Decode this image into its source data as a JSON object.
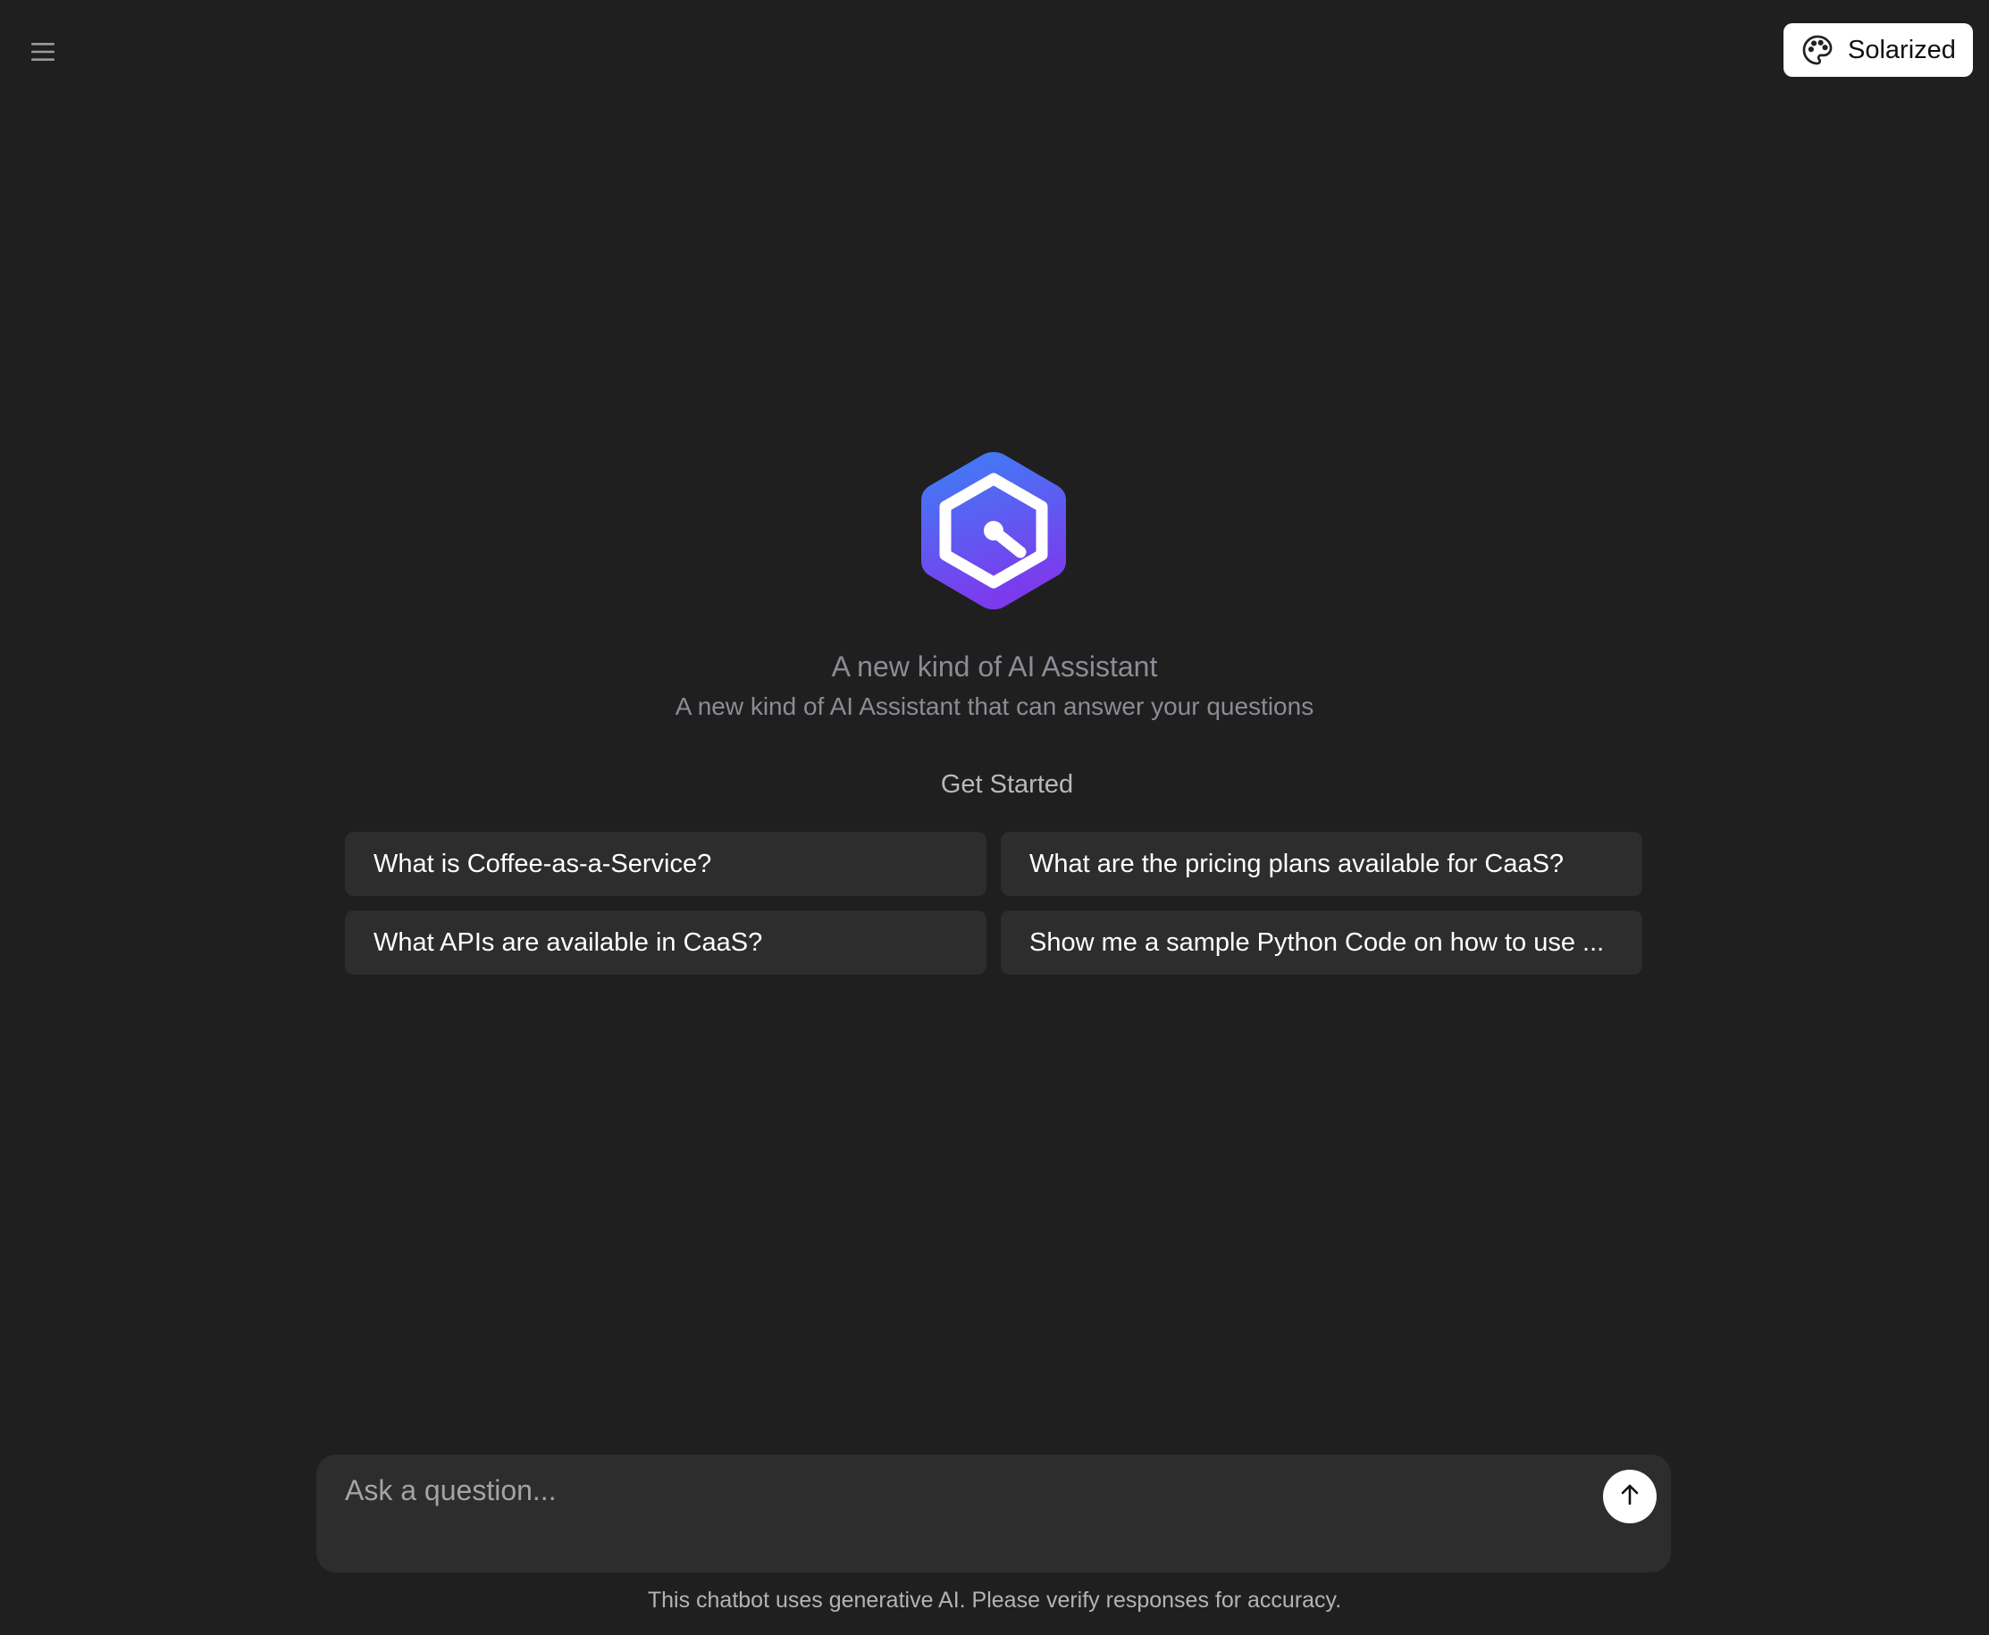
{
  "header": {
    "menu_icon": "hamburger-menu-icon",
    "theme_button": {
      "icon": "palette-icon",
      "label": "Solarized"
    }
  },
  "hero": {
    "logo_icon": "hexagon-assistant-logo",
    "title": "A new kind of AI Assistant",
    "subtitle": "A new kind of AI Assistant that can answer your questions"
  },
  "get_started": {
    "heading": "Get Started",
    "suggestions": [
      "What is Coffee-as-a-Service?",
      "What are the pricing plans available for CaaS?",
      "What APIs are available in CaaS?",
      "Show me a sample Python Code on how to use ..."
    ]
  },
  "composer": {
    "placeholder": "Ask a question...",
    "value": "",
    "send_icon": "arrow-up-icon"
  },
  "footer": {
    "disclaimer": "This chatbot uses generative AI. Please verify responses for accuracy."
  },
  "colors": {
    "background": "#1f1f1f",
    "card": "#2d2d2d",
    "logo_gradient_top": "#3b82f6",
    "logo_gradient_bottom": "#7c3aed"
  }
}
